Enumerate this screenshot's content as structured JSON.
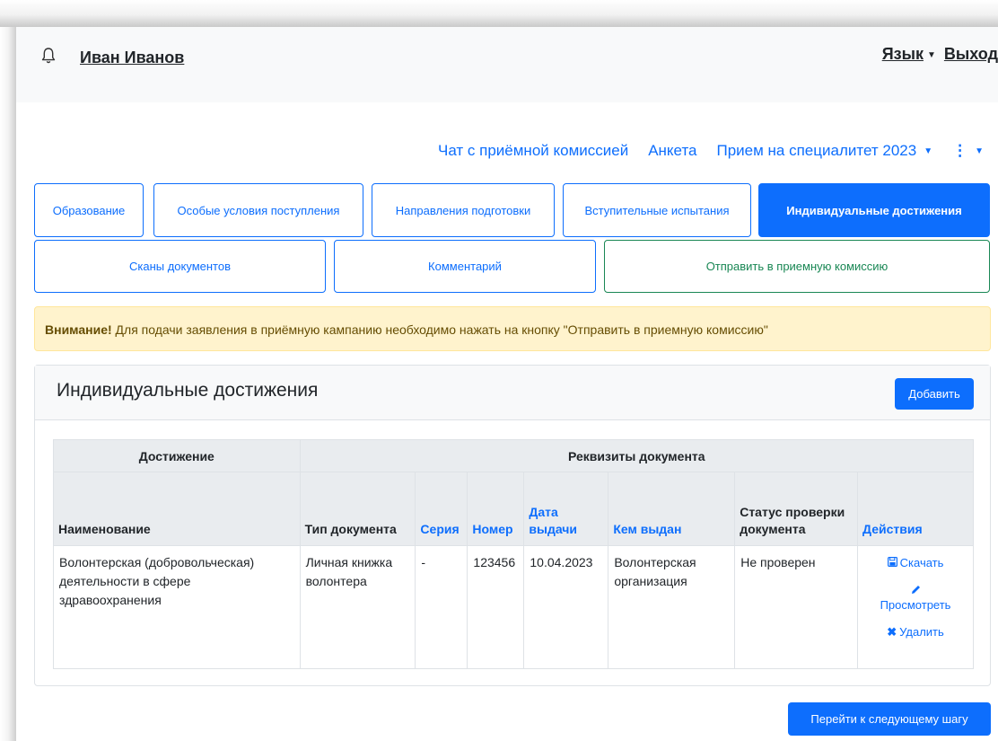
{
  "header": {
    "user_name": "Иван Иванов",
    "language_link": "Язык",
    "logout_link": "Выход"
  },
  "nav": {
    "chat": "Чат с приёмной комиссией",
    "form": "Анкета",
    "campaign": "Прием на специалитет 2023"
  },
  "tabs_row1": [
    {
      "label": "Образование"
    },
    {
      "label": "Особые условия поступления"
    },
    {
      "label": "Направления подготовки"
    },
    {
      "label": "Вступительные испытания"
    },
    {
      "label": "Индивидуальные достижения",
      "active": true
    }
  ],
  "tabs_row2": [
    {
      "label": "Сканы документов"
    },
    {
      "label": "Комментарий"
    },
    {
      "label": "Отправить в приемную комиссию"
    }
  ],
  "alert": {
    "strong": "Внимание!",
    "text": " Для подачи заявления в приёмную кампанию необходимо нажать на кнопку \"Отправить в приемную комиссию\""
  },
  "card": {
    "title": "Индивидуальные достижения",
    "add_button": "Добавить"
  },
  "table": {
    "group_headers": [
      "Достижение",
      "Реквизиты документа"
    ],
    "columns": [
      "Наименование",
      "Тип документа",
      "Серия",
      "Номер",
      "Дата выдачи",
      "Кем выдан",
      "Статус проверки документа",
      "Действия"
    ],
    "rows": [
      {
        "name": "Волонтерская (добровольческая) деятельности в сфере здравоохранения",
        "doc_type": "Личная книжка волонтера",
        "series": "-",
        "number": "123456",
        "issue_date": "10.04.2023",
        "issued_by": "Волонтерская организация",
        "status": "Не проверен"
      }
    ],
    "actions": {
      "download": "Скачать",
      "view": "Просмотреть",
      "delete": "Удалить"
    }
  },
  "footer": {
    "next_button": "Перейти к следующему шагу"
  },
  "colors": {
    "primary": "#0d6efd",
    "success": "#198754",
    "alert_bg": "#fff3cd",
    "header_bg": "#f8f9fa"
  },
  "icons": [
    "bell-icon",
    "caret-down-icon",
    "kebab-menu-icon",
    "floppy-disk-icon",
    "pencil-icon",
    "close-x-icon"
  ]
}
